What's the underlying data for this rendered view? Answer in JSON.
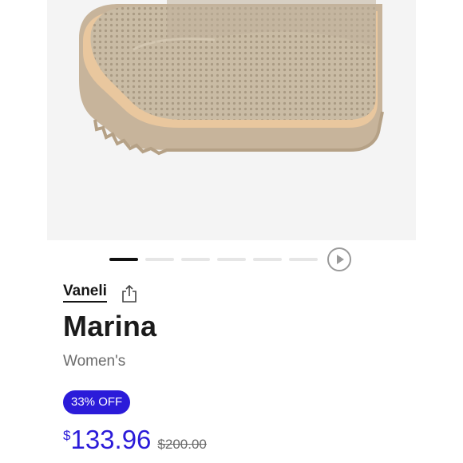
{
  "product": {
    "brand": "Vaneli",
    "name": "Marina",
    "gender": "Women's",
    "discount_badge": "33% OFF",
    "currency_symbol": "$",
    "sale_price": "133.96",
    "original_price": "$200.00"
  },
  "gallery": {
    "image_description": "beige knit boot with lug sole",
    "slide_count": 6,
    "active_slide": 1,
    "has_video": true
  },
  "colors": {
    "accent": "#2b1bd9",
    "image_background": "#f4f4f4",
    "active_indicator": "#111111",
    "inactive_indicator": "#e6e6e6"
  },
  "icons": [
    "share-icon",
    "play-icon"
  ]
}
